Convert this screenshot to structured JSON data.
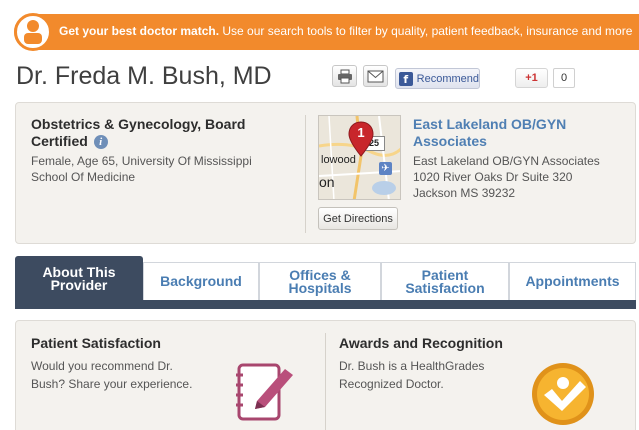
{
  "banner": {
    "bold_text": "Get your best doctor match.",
    "text": " Use our search tools to filter by quality, patient feedback, insurance and more"
  },
  "doctor": {
    "name": "Dr. Freda M. Bush, MD"
  },
  "share": {
    "print_icon": "printer-icon",
    "email_icon": "envelope-icon",
    "facebook_label": "Recommend",
    "facebook_logo": "f",
    "gplus_label": "+1",
    "gplus_count": "0"
  },
  "info": {
    "specialty": "Obstetrics & Gynecology, Board Certified",
    "info_icon": "i",
    "bio_line1": "Female, Age 65, University Of Mississippi",
    "bio_line2": "School Of Medicine"
  },
  "map": {
    "pin_number": "1",
    "city_label": "lowood",
    "on_label": "on",
    "highway_shield": "25",
    "plane_icon": "airport-icon",
    "directions_label": "Get Directions"
  },
  "practice": {
    "name": "East Lakeland OB/GYN Associates",
    "address_line1": "East Lakeland OB/GYN Associates",
    "address_line2": "1020 River Oaks Dr Suite 320",
    "address_line3": "Jackson MS 39232"
  },
  "tabs": [
    {
      "line1": "About This",
      "line2": "Provider"
    },
    {
      "line1": "Background",
      "line2": ""
    },
    {
      "line1": "Offices &",
      "line2": "Hospitals"
    },
    {
      "line1": "Patient",
      "line2": "Satisfaction"
    },
    {
      "line1": "Appointments",
      "line2": ""
    }
  ],
  "patient_satisfaction": {
    "title": "Patient Satisfaction",
    "text_line1": "Would you recommend Dr.",
    "text_line2": "Bush? Share your experience."
  },
  "awards": {
    "title": "Awards and Recognition",
    "text_line1": "Dr. Bush is a HealthGrades",
    "text_line2": "Recognized Doctor."
  },
  "colors": {
    "banner": "#f28a2c",
    "link_blue": "#4f7fb3",
    "tab_active": "#3d4b60",
    "card_bg": "#f4f2ee",
    "notebook": "#a8466e",
    "award": "#f0a020"
  }
}
